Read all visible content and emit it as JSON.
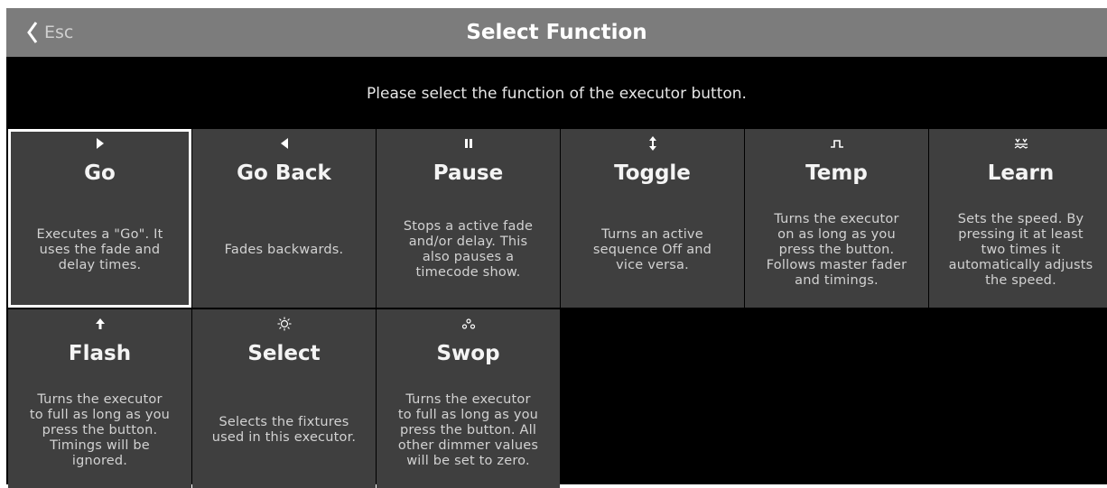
{
  "header": {
    "esc_label": "Esc",
    "title": "Select Function"
  },
  "message": "Please select the function of the executor button.",
  "functions": [
    {
      "label": "Go",
      "icon": "play-icon",
      "description": "Executes a \"Go\". It\nuses the fade and\ndelay times.",
      "selected": true
    },
    {
      "label": "Go Back",
      "icon": "play-back-icon",
      "description": "Fades backwards."
    },
    {
      "label": "Pause",
      "icon": "pause-icon",
      "description": "Stops a active fade\nand/or delay. This\nalso pauses a\ntimecode show."
    },
    {
      "label": "Toggle",
      "icon": "toggle-icon",
      "description": "Turns an active\nsequence Off and\nvice versa."
    },
    {
      "label": "Temp",
      "icon": "pulse-icon",
      "description": "Turns the executor\non as long as you\npress the button.\nFollows master fader\nand timings."
    },
    {
      "label": "Learn",
      "icon": "learn-icon",
      "description": "Sets the speed. By\npressing it at least\ntwo times it\nautomatically adjusts\nthe speed."
    },
    {
      "label": "Flash",
      "icon": "up-arrow-icon",
      "description": "Turns the executor\nto full as long as you\npress the button.\nTimings will be\nignored."
    },
    {
      "label": "Select",
      "icon": "bulb-icon",
      "description": "Selects the fixtures\nused in this executor."
    },
    {
      "label": "Swop",
      "icon": "swop-icon",
      "description": "Turns the executor\nto full as long as you\npress the button. All\nother dimmer values\nwill be set to zero."
    }
  ],
  "colors": {
    "titlebar": "#7c7c7c",
    "cell": "#3f3f3f",
    "background": "#000000",
    "selection": "#ffffff"
  }
}
